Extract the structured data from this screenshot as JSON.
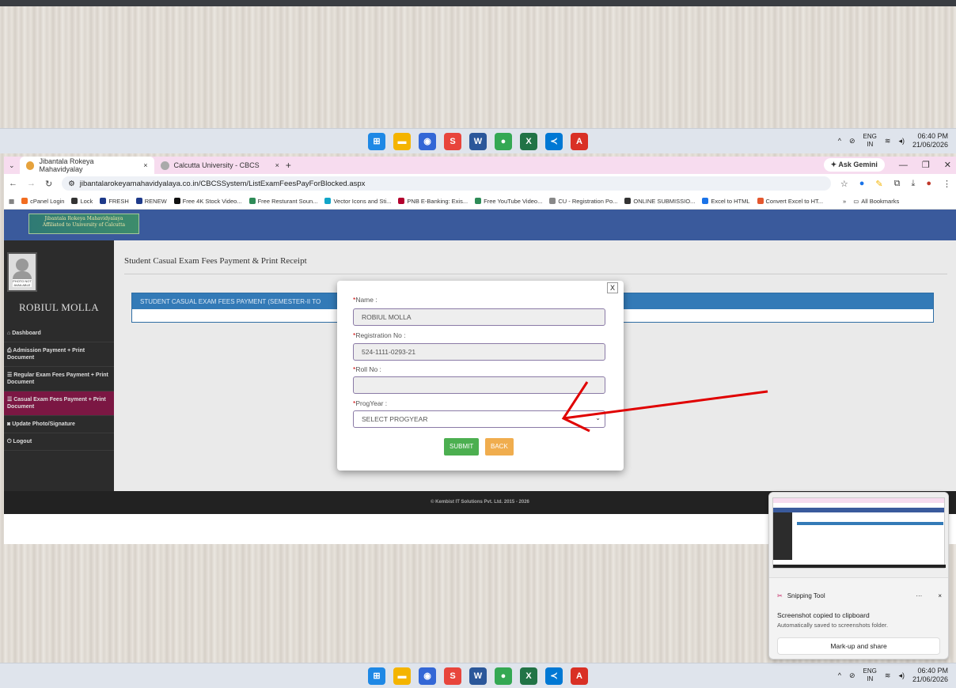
{
  "taskbar": {
    "time": "06:40 PM",
    "date": "21/06/2026",
    "lang_top": "ENG",
    "lang_bottom": "IN"
  },
  "browser": {
    "tabs": [
      {
        "label": "Jibantala Rokeya Mahavidyalay",
        "close": "×"
      },
      {
        "label": "Calcutta University - CBCS",
        "close": "×"
      }
    ],
    "new_tab": "+",
    "ask_gemini": "Ask Gemini",
    "url": "jibantalarokeyamahavidyalaya.co.in/CBCSSystem/ListExamFeesPayForBlocked.aspx",
    "bookmarks": [
      {
        "label": "cPanel Login",
        "color": "#f26d21"
      },
      {
        "label": "Lock",
        "color": "#333333"
      },
      {
        "label": "FRESH",
        "color": "#1e3a8a"
      },
      {
        "label": "RENEW",
        "color": "#1e3a8a"
      },
      {
        "label": "Free 4K Stock Video...",
        "color": "#111111"
      },
      {
        "label": "Free Resturant Soun...",
        "color": "#2e8b57"
      },
      {
        "label": "Vector Icons and Sti...",
        "color": "#11a5c8"
      },
      {
        "label": "PNB E-Banking: Exis...",
        "color": "#b3002d"
      },
      {
        "label": "Free YouTube Video...",
        "color": "#2e8b57"
      },
      {
        "label": "CU - Registration Po...",
        "color": "#888888"
      },
      {
        "label": "ONLINE SUBMISSIO...",
        "color": "#333333"
      },
      {
        "label": "Excel to HTML",
        "color": "#1a73e8"
      },
      {
        "label": "Convert Excel to HT...",
        "color": "#e4572e"
      }
    ],
    "more_bookmarks": "»",
    "all_bookmarks": "All Bookmarks"
  },
  "site": {
    "logo_line1": "Jibantala Rokeya Mahavidyalaya",
    "logo_line2": "Affiliated to University of Calcutta",
    "user_name": "ROBIUL MOLLA",
    "avatar_text": "PHOTO NOT AVAILABLE",
    "menu": [
      {
        "label": "Dashboard",
        "icon": "home-icon",
        "active": false
      },
      {
        "label": "Admission Payment + Print Document",
        "icon": "print-icon",
        "active": false
      },
      {
        "label": "Regular Exam Fees Payment + Print Document",
        "icon": "list-icon",
        "active": false
      },
      {
        "label": "Casual Exam Fees Payment + Print Document",
        "icon": "list-icon",
        "active": true
      },
      {
        "label": "Update Photo/Signature",
        "icon": "camera-icon",
        "active": false
      },
      {
        "label": "Logout",
        "icon": "power-icon",
        "active": false
      }
    ],
    "page_title": "Student Casual Exam Fees Payment & Print Receipt",
    "panel_heading": "STUDENT CASUAL EXAM FEES PAYMENT (SEMESTER-II TO",
    "footer": "© Kembist IT Solutions Pvt. Ltd. 2015 - 2026"
  },
  "modal": {
    "close": "X",
    "name_label": "Name :",
    "name_value": "ROBIUL MOLLA",
    "reg_label": "Registration No :",
    "reg_value": "524-1111-0293-21",
    "roll_label": "Roll No :",
    "roll_value": "",
    "progyear_label": "ProgYear :",
    "progyear_value": "SELECT PROGYEAR",
    "required_mark": "*",
    "submit": "SUBMIT",
    "back": "BACK"
  },
  "snipping": {
    "app": "Snipping Tool",
    "more": "···",
    "close": "×",
    "title": "Screenshot copied to clipboard",
    "subtitle": "Automatically saved to screenshots folder.",
    "button": "Mark-up and share"
  },
  "colors": {
    "header_blue": "#3a5a9c",
    "active_menu": "#7b1743",
    "submit_green": "#4caf50",
    "back_orange": "#f0ad4e",
    "arrow_red": "#e00000"
  }
}
